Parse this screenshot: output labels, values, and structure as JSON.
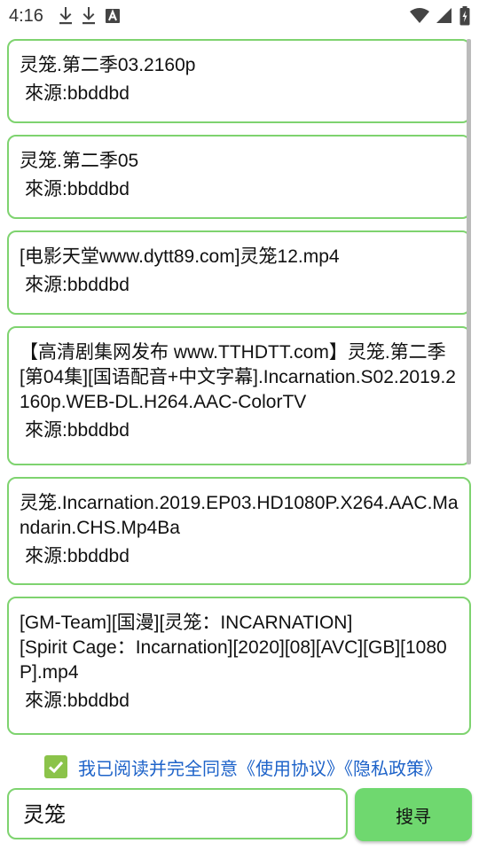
{
  "status_bar": {
    "time": "4:16",
    "left_icons": [
      "download-icon",
      "download-icon",
      "font-a-icon"
    ],
    "right_icons": [
      "wifi-icon",
      "signal-icon",
      "battery-icon"
    ]
  },
  "results": [
    {
      "title": "灵笼.第二季03.2160p",
      "source": "來源:bbddbd"
    },
    {
      "title": "灵笼.第二季05",
      "source": "來源:bbddbd"
    },
    {
      "title": "[电影天堂www.dytt89.com]灵笼12.mp4",
      "source": "來源:bbddbd"
    },
    {
      "title": "【高清剧集网发布 www.TTHDTT.com】灵笼.第二季[第04集][国语配音+中文字幕].Incarnation.S02.2019.2160p.WEB-DL.H264.AAC-ColorTV",
      "source": "來源:bbddbd"
    },
    {
      "title": "灵笼.Incarnation.2019.EP03.HD1080P.X264.AAC.Mandarin.CHS.Mp4Ba",
      "source": "來源:bbddbd"
    },
    {
      "title": "[GM-Team][国漫][灵笼：INCARNATION]\n[Spirit Cage：Incarnation][2020][08][AVC][GB][1080P].mp4",
      "source": "來源:bbddbd"
    }
  ],
  "agreement": {
    "checked": true,
    "text": "我已阅读并完全同意《使用协议》《隐私政策》"
  },
  "search": {
    "value": "灵笼",
    "button_label": "搜寻"
  },
  "colors": {
    "accent_border": "#7ed36f",
    "button_bg": "#6fd86f",
    "checkbox": "#8bc34a",
    "link_blue": "#1e63c9"
  }
}
